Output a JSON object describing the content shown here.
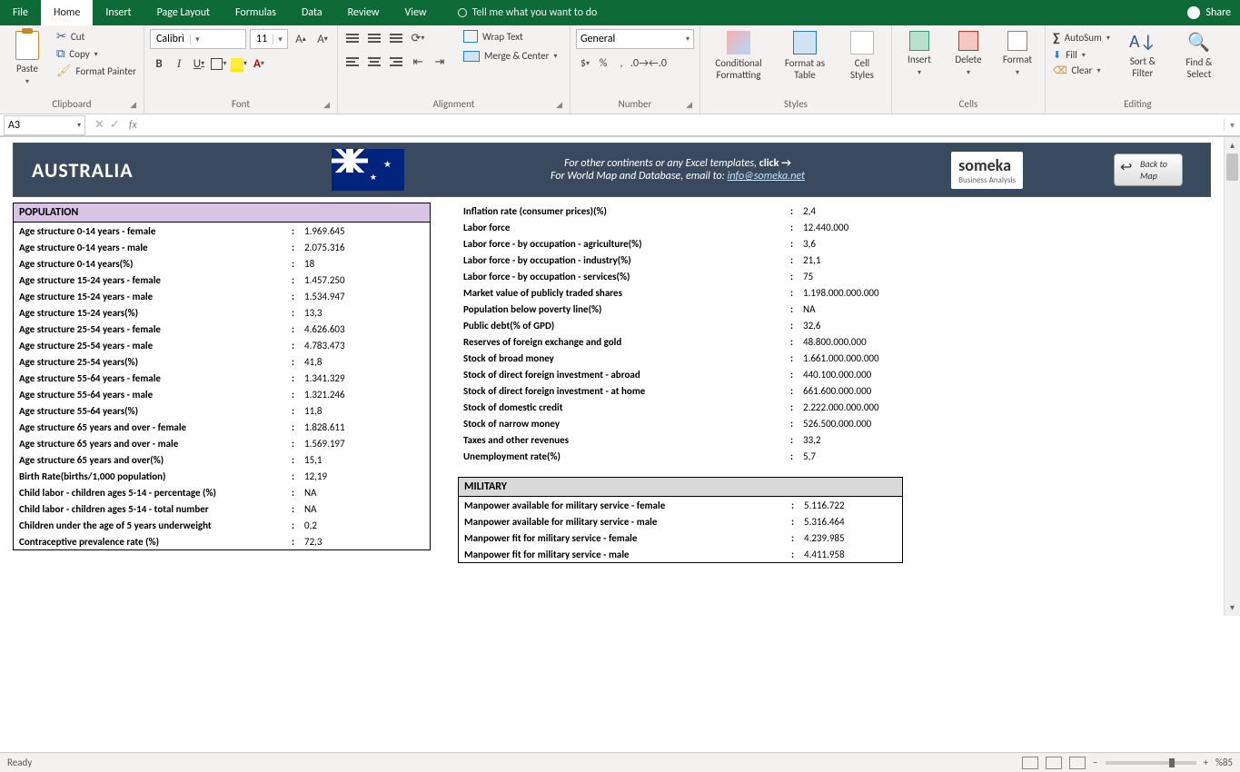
{
  "app": {
    "tabs": [
      "File",
      "Home",
      "Insert",
      "Page Layout",
      "Formulas",
      "Data",
      "Review",
      "View"
    ],
    "active_tab": "Home",
    "tell_me": "Tell me what you want to do",
    "share": "Share"
  },
  "ribbon": {
    "clipboard": {
      "label": "Clipboard",
      "paste": "Paste",
      "cut": "Cut",
      "copy": "Copy",
      "painter": "Format Painter"
    },
    "font": {
      "label": "Font",
      "name": "Calibri",
      "size": "11"
    },
    "alignment": {
      "label": "Alignment",
      "wrap": "Wrap Text",
      "merge": "Merge & Center"
    },
    "number": {
      "label": "Number",
      "format": "General"
    },
    "styles": {
      "label": "Styles",
      "cf": "Conditional Formatting",
      "ft": "Format as Table",
      "cs": "Cell Styles"
    },
    "cells": {
      "label": "Cells",
      "insert": "Insert",
      "delete": "Delete",
      "format": "Format"
    },
    "editing": {
      "label": "Editing",
      "sum": "AutoSum",
      "fill": "Fill",
      "clear": "Clear",
      "sort": "Sort & Filter",
      "find": "Find & Select"
    }
  },
  "fbar": {
    "name": "A3",
    "fx": "fx"
  },
  "header": {
    "country": "AUSTRALIA",
    "line1_pre": "For other continents or any Excel templates, ",
    "line1_click": "click",
    "line2_pre": "For World Map and Database, email to: ",
    "email": "info@someka.net",
    "someka1": "someka",
    "someka2": "Business Analysis",
    "back": "Back to Map"
  },
  "population": {
    "title": "POPULATION",
    "rows": [
      [
        "Age structure 0-14 years - female",
        "1.969.645"
      ],
      [
        "Age structure 0-14 years - male",
        "2.075.316"
      ],
      [
        "Age structure 0-14 years(%)",
        "18"
      ],
      [
        "Age structure 15-24 years - female",
        "1.457.250"
      ],
      [
        "Age structure 15-24 years - male",
        "1.534.947"
      ],
      [
        "Age structure 15-24 years(%)",
        "13,3"
      ],
      [
        "Age structure 25-54 years - female",
        "4.626.603"
      ],
      [
        "Age structure 25-54 years - male",
        "4.783.473"
      ],
      [
        "Age structure 25-54 years(%)",
        "41,8"
      ],
      [
        "Age structure 55-64 years - female",
        "1.341.329"
      ],
      [
        "Age structure 55-64 years - male",
        "1.321.246"
      ],
      [
        "Age structure 55-64 years(%)",
        "11,8"
      ],
      [
        "Age structure 65 years and over - female",
        "1.828.611"
      ],
      [
        "Age structure 65 years and over - male",
        "1.569.197"
      ],
      [
        "Age structure 65 years and over(%)",
        "15,1"
      ],
      [
        "Birth Rate(births/1,000 population)",
        "12,19"
      ],
      [
        "Child labor - children ages 5-14 - percentage (%)",
        "NA"
      ],
      [
        "Child labor - children ages 5-14 - total number",
        "NA"
      ],
      [
        "Children under the age of 5 years underweight",
        "0,2"
      ],
      [
        "Contraceptive prevalence rate (%)",
        "72,3"
      ]
    ]
  },
  "economy": {
    "rows": [
      [
        "Inflation rate (consumer prices)(%)",
        "2,4"
      ],
      [
        "Labor force",
        "12.440.000"
      ],
      [
        "Labor force - by occupation - agriculture(%)",
        "3,6"
      ],
      [
        "Labor force - by occupation - industry(%)",
        "21,1"
      ],
      [
        "Labor force - by occupation - services(%)",
        "75"
      ],
      [
        "Market value of publicly traded shares",
        "1.198.000.000.000"
      ],
      [
        "Population below poverty line(%)",
        "NA"
      ],
      [
        "Public debt(% of GPD)",
        "32,6"
      ],
      [
        "Reserves of foreign exchange and gold",
        "48.800.000.000"
      ],
      [
        "Stock of broad money",
        "1.661.000.000.000"
      ],
      [
        "Stock of direct foreign investment - abroad",
        "440.100.000.000"
      ],
      [
        "Stock of direct foreign investment - at home",
        "661.600.000.000"
      ],
      [
        "Stock of domestic credit",
        "2.222.000.000.000"
      ],
      [
        "Stock of narrow money",
        "526.500.000.000"
      ],
      [
        "Taxes and other revenues",
        "33,2"
      ],
      [
        "Unemployment rate(%)",
        "5,7"
      ]
    ]
  },
  "military": {
    "title": "MILITARY",
    "rows": [
      [
        "Manpower available for military service - female",
        "5.116.722"
      ],
      [
        "Manpower available for military service - male",
        "5.316.464"
      ],
      [
        "Manpower fit for military service - female",
        "4.239.985"
      ],
      [
        "Manpower fit for military service - male",
        "4.411.958"
      ]
    ]
  },
  "status": {
    "ready": "Ready",
    "zoom": "%85"
  }
}
